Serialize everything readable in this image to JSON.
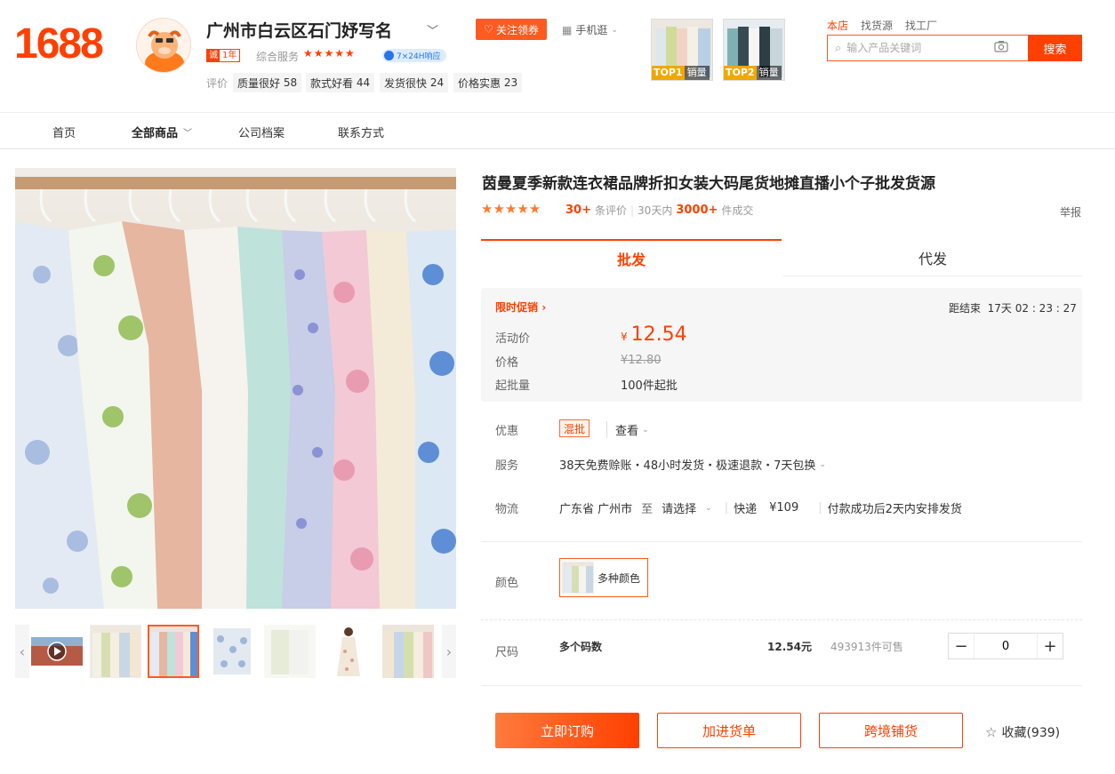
{
  "brand": {
    "logo_text": "1688"
  },
  "shop": {
    "name": "广州市白云区石门妤写名",
    "follow_label": "关注领券",
    "mobile_label": "手机逛",
    "year_badge_prefix": "诚",
    "year_badge": "1年",
    "service_label": "综合服务",
    "service_stars": "★★★★★",
    "response_badge": "7×24H响应",
    "rating_label": "评价",
    "rating_tags": [
      {
        "label": "质量很好",
        "count": "58"
      },
      {
        "label": "款式好看",
        "count": "44"
      },
      {
        "label": "发货很快",
        "count": "24"
      },
      {
        "label": "价格实惠",
        "count": "23"
      }
    ]
  },
  "top_products": [
    {
      "rank": "TOP1",
      "label": "销量"
    },
    {
      "rank": "TOP2",
      "label": "销量"
    }
  ],
  "search": {
    "tabs": [
      "本店",
      "找货源",
      "找工厂"
    ],
    "active_tab": 0,
    "placeholder": "输入产品关键词",
    "button_label": "搜索"
  },
  "nav": {
    "items": [
      "首页",
      "全部商品",
      "公司档案",
      "联系方式"
    ],
    "active": 1
  },
  "product": {
    "title": "茵曼夏季新款连衣裙品牌折扣女装大码尾货地摊直播小个子批发货源",
    "stars": "★★★★★",
    "review_count": "30+",
    "review_label": "条评价",
    "period_label": "30天内",
    "sold_count": "3000+",
    "sold_label": "件成交",
    "report_label": "举报"
  },
  "tabs": [
    {
      "label": "批发"
    },
    {
      "label": "代发"
    }
  ],
  "promo": {
    "label": "限时促销",
    "countdown_label": "距结束",
    "countdown": "17天 02 : 23 : 27",
    "activity_price_label": "活动价",
    "currency": "¥",
    "activity_price": "12.54",
    "price_label": "价格",
    "original_price": "¥12.80",
    "moq_label": "起批量",
    "moq": "100件起批"
  },
  "details": {
    "discount_label": "优惠",
    "discount_tag": "混批",
    "view_label": "查看",
    "service_label": "服务",
    "service_text": "38天免费赊账・48小时发货・极速退款・7天包换",
    "logistics_label": "物流",
    "origin": "广东省 广州市",
    "to_label": "至",
    "destination": "请选择",
    "express": "快递",
    "shipping_fee": "¥109",
    "ship_note": "付款成功后2天内安排发货"
  },
  "options": {
    "color_label": "颜色",
    "color_value": "多种颜色",
    "size_label": "尺码",
    "size_value": "多个码数",
    "size_price": "12.54元",
    "size_stock": "493913件可售",
    "quantity": "0"
  },
  "actions": {
    "order": "立即订购",
    "cart": "加进货单",
    "cross_border": "跨境铺货",
    "favorite": "收藏(939)"
  },
  "colors": {
    "accent": "#ff4000",
    "star": "#ff7a2e"
  }
}
